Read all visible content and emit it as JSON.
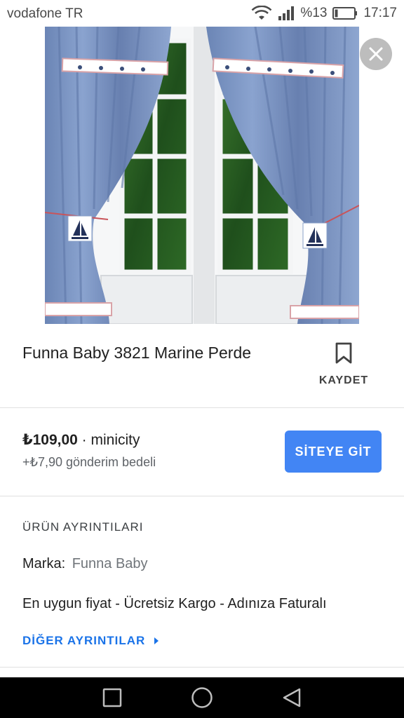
{
  "status_bar": {
    "carrier": "vodafone TR",
    "battery_percent": "%13",
    "time": "17:17"
  },
  "image": {
    "icon": "curtain-photo",
    "close_icon": "close-icon"
  },
  "product": {
    "title": "Funna Baby 3821 Marine Perde",
    "save_label": "KAYDET",
    "save_icon": "bookmark-icon"
  },
  "offer": {
    "price": "₺109,00",
    "separator": " · ",
    "merchant": "minicity",
    "shipping": "+₺7,90 gönderim bedeli",
    "visit_label": "SİTEYE GİT"
  },
  "details": {
    "heading": "ÜRÜN AYRINTILARI",
    "brand_label": "Marka:",
    "brand_value": "Funna Baby",
    "description": "En uygun fiyat - Ücretsiz Kargo - Adınıza Faturalı",
    "more_label": "DİĞER AYRINTILAR"
  },
  "colors": {
    "accent": "#4285f4",
    "link": "#1a73e8"
  }
}
